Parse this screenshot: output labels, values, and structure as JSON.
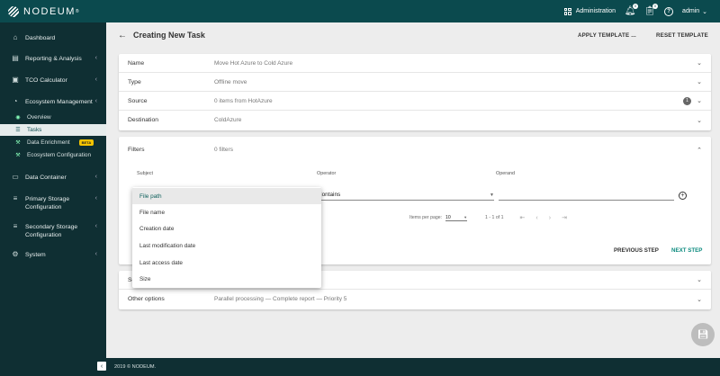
{
  "brand": {
    "name": "NODEUM",
    "reg": "®"
  },
  "topbar": {
    "administration": "Administration",
    "notifications_badge": "0",
    "tasks_badge": "0",
    "user": "admin"
  },
  "sidebar": {
    "items": [
      {
        "label": "Dashboard",
        "icon": "home-icon"
      },
      {
        "label": "Reporting & Analysis",
        "icon": "chart-icon"
      },
      {
        "label": "TCO Calculator",
        "icon": "calculator-icon"
      },
      {
        "label": "Ecosystem Management",
        "icon": "gauge-icon"
      },
      {
        "label": "Data Container",
        "icon": "folder-icon"
      },
      {
        "label": "Primary Storage Configuration",
        "icon": "storage-icon"
      },
      {
        "label": "Secondary Storage Configuration",
        "icon": "storage-icon"
      },
      {
        "label": "System",
        "icon": "gear-icon"
      }
    ],
    "subitems": [
      {
        "label": "Overview",
        "icon": "eye-icon"
      },
      {
        "label": "Tasks",
        "icon": "tasks-icon"
      },
      {
        "label": "Data Enrichment",
        "icon": "wrench-icon",
        "badge": "BETA"
      },
      {
        "label": "Ecosystem Configuration",
        "icon": "wrench-icon"
      }
    ]
  },
  "header": {
    "title": "Creating New Task",
    "apply_template": "APPLY TEMPLATE ...",
    "reset_template": "RESET TEMPLATE"
  },
  "task": {
    "name": {
      "label": "Name",
      "value": "Move Hot Azure to Cold Azure"
    },
    "type": {
      "label": "Type",
      "value": "Offline move"
    },
    "source": {
      "label": "Source",
      "value": "0 items from HotAzure",
      "info": "1"
    },
    "destination": {
      "label": "Destination",
      "value": "ColdAzure"
    }
  },
  "filters": {
    "label": "Filters",
    "value": "0 filters",
    "subject_header": "Subject",
    "operator_header": "Operator",
    "operand_header": "Operand",
    "operator_value": "Contains",
    "items_per_page_label": "Items per page:",
    "items_per_page": "10",
    "range": "1 - 1 of 1",
    "previous_step": "PREVIOUS STEP",
    "next_step": "NEXT STEP"
  },
  "subject_options": [
    "File path",
    "File name",
    "Creation date",
    "Last modification date",
    "Last access date",
    "Size"
  ],
  "schedule": {
    "label": "Sc"
  },
  "other_options": {
    "label": "Other options",
    "value": "Parallel processing — Complete report — Priority 5"
  },
  "footer": {
    "text": "2019 © NODEUM."
  },
  "colors": {
    "topbar": "#0b4a4e",
    "sidebar": "#0f2f33",
    "accent": "#0b8a7e"
  }
}
